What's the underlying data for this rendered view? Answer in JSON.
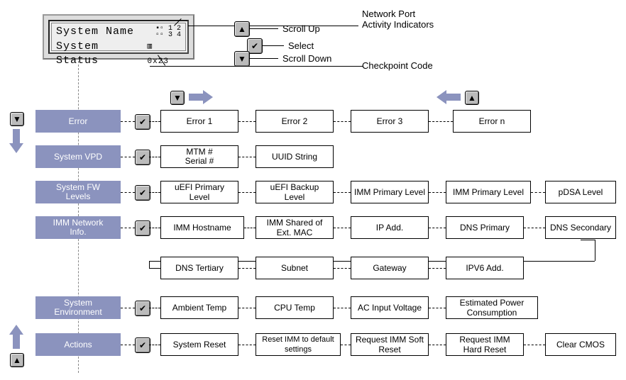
{
  "lcd": {
    "line1": "System Name",
    "line2_left": "System Status",
    "line2_code": "0x23",
    "port_indicator_glyph": "▪▫ 1 2\n▫▫ 3 4",
    "checkpoint_glyph": "▥"
  },
  "legend": {
    "scroll_up": "Scroll Up",
    "select": "Select",
    "scroll_down": "Scroll Down",
    "network_port": "Network Port\nActivity Indicators",
    "checkpoint": "Checkpoint Code"
  },
  "icons": {
    "up": "▲",
    "down": "▼",
    "check": "✔"
  },
  "rows": {
    "error": {
      "label": "Error",
      "items": [
        "Error 1",
        "Error 2",
        "Error 3",
        "Error n"
      ]
    },
    "vpd": {
      "label": "System VPD",
      "items": [
        "MTM #\nSerial #",
        "UUID String"
      ]
    },
    "fw": {
      "label": "System FW\nLevels",
      "items": [
        "uEFI Primary Level",
        "uEFI Backup Level",
        "IMM Primary Level",
        "IMM Primary Level",
        "pDSA Level"
      ]
    },
    "net": {
      "label": "IMM Network\nInfo.",
      "items_a": [
        "IMM Hostname",
        "IMM Shared of Ext. MAC",
        "IP Add.",
        "DNS Primary",
        "DNS Secondary"
      ],
      "items_b": [
        "DNS Tertiary",
        "Subnet",
        "Gateway",
        "IPV6 Add."
      ]
    },
    "env": {
      "label": "System\nEnvironment",
      "items": [
        "Ambient Temp",
        "CPU Temp",
        "AC Input Voltage",
        "Estimated Power Consumption"
      ]
    },
    "actions": {
      "label": "Actions",
      "items": [
        "System Reset",
        "Reset IMM to default settings",
        "Request IMM Soft Reset",
        "Request IMM Hard Reset",
        "Clear CMOS"
      ]
    }
  }
}
